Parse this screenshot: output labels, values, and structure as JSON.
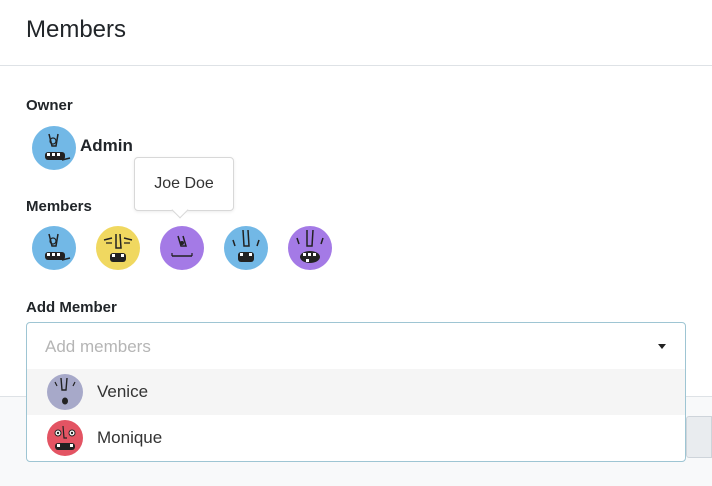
{
  "modal": {
    "title": "Members"
  },
  "owner": {
    "label": "Owner",
    "name": "Admin",
    "avatar_icon": "monster-face-blue",
    "avatar_color": "#72b8e6"
  },
  "members": {
    "label": "Members",
    "tooltip": "Joe Doe",
    "avatars": [
      {
        "icon": "monster-face-blue",
        "color": "#72b8e6"
      },
      {
        "icon": "monster-face-yellow",
        "color": "#f0d860"
      },
      {
        "icon": "monster-face-purple",
        "color": "#a47ae6"
      },
      {
        "icon": "monster-face-blue",
        "color": "#72b8e6"
      },
      {
        "icon": "monster-face-purple",
        "color": "#a47ae6"
      }
    ]
  },
  "add_member": {
    "label": "Add Member",
    "placeholder": "Add members",
    "options": [
      {
        "name": "Venice",
        "icon": "monster-face-gray",
        "color": "#a7a9c9"
      },
      {
        "name": "Monique",
        "icon": "monster-face-red",
        "color": "#e35463"
      }
    ]
  },
  "colors": {
    "select_border": "#9ec5d3",
    "highlight": "#f5f5f5"
  }
}
